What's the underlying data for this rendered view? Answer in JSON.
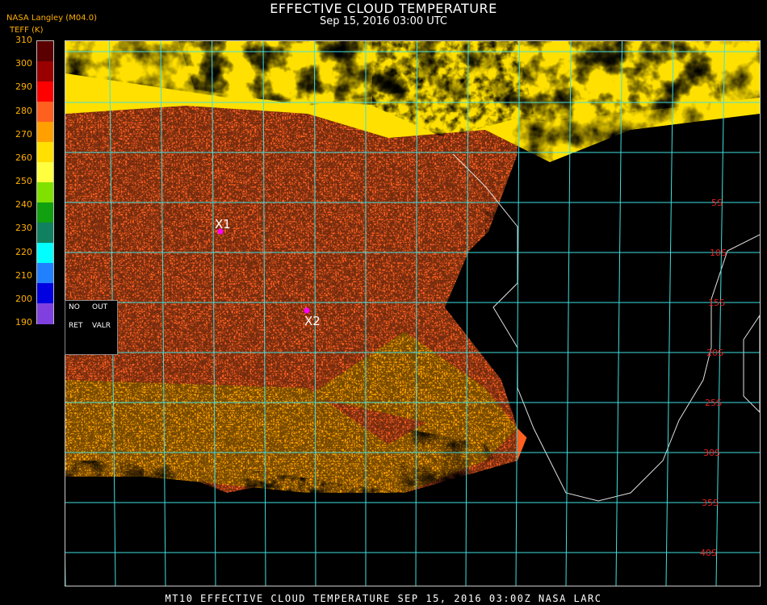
{
  "header": {
    "title": "EFFECTIVE CLOUD TEMPERATURE",
    "datetime": "Sep 15, 2016 03:00 UTC",
    "agency": "NASA Langley (M04.0)",
    "units": "TEFF (K)"
  },
  "colorbar": {
    "labels": [
      "310",
      "300",
      "290",
      "280",
      "270",
      "260",
      "250",
      "240",
      "230",
      "220",
      "210",
      "200",
      "190"
    ],
    "colors": [
      "#5a0000",
      "#9a0000",
      "#ff0000",
      "#ff6020",
      "#ffa000",
      "#ffe000",
      "#ffff40",
      "#80e000",
      "#10a010",
      "#108060",
      "#00ffff",
      "#2080ff",
      "#0000e0",
      "#8040e0"
    ]
  },
  "map": {
    "lat_labels": [
      "5S",
      "10S",
      "15S",
      "20S",
      "25S",
      "30S",
      "35S",
      "40S"
    ],
    "markers": [
      {
        "label": "X1",
        "color": "#ff00ff"
      },
      {
        "label": "X2",
        "color": "#ff00ff"
      }
    ],
    "grid_color": "#40e0e0"
  },
  "legend": {
    "no": "NO",
    "out": "OUT",
    "ret": "RET",
    "valr": "VALR"
  },
  "footer": {
    "text": "MT10  EFFECTIVE CLOUD TEMPERATURE   SEP 15, 2016 03:00Z   NASA LARC"
  }
}
